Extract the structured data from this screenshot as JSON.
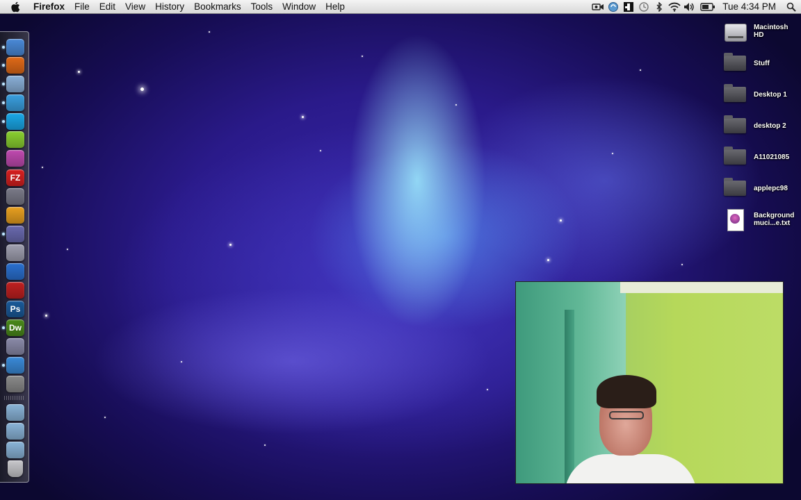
{
  "menubar": {
    "apple_icon": "apple-icon",
    "app_name": "Firefox",
    "menus": [
      "File",
      "Edit",
      "View",
      "History",
      "Bookmarks",
      "Tools",
      "Window",
      "Help"
    ],
    "status_icons": [
      "video-camera-icon",
      "sync-icon",
      "extension-icon",
      "time-machine-icon",
      "bluetooth-icon",
      "wifi-icon",
      "volume-icon",
      "battery-icon"
    ],
    "clock": "Tue 4:34 PM",
    "spotlight_icon": "search-icon"
  },
  "dock": {
    "items": [
      {
        "name": "finder",
        "icon": "finder-icon",
        "color": "#4a8ad8",
        "running": true
      },
      {
        "name": "firefox",
        "icon": "firefox-icon",
        "color": "#e06a18",
        "running": true
      },
      {
        "name": "preview",
        "icon": "preview-icon",
        "color": "#8ab0d8",
        "running": true
      },
      {
        "name": "itunes",
        "icon": "itunes-icon",
        "color": "#3aa0e0",
        "running": true
      },
      {
        "name": "skype",
        "icon": "skype-icon",
        "color": "#1aa8e8",
        "running": true
      },
      {
        "name": "limewire",
        "icon": "limewire-icon",
        "color": "#8ad030",
        "running": false
      },
      {
        "name": "photo-app",
        "icon": "photo-app-icon",
        "color": "#c04ab0",
        "running": false
      },
      {
        "name": "filezilla",
        "icon": "filezilla-icon",
        "color": "#d82020",
        "label": "FZ",
        "running": false
      },
      {
        "name": "script-editor",
        "icon": "script-editor-icon",
        "color": "#7a7a88",
        "running": false
      },
      {
        "name": "burn",
        "icon": "burn-icon",
        "color": "#e8a020",
        "running": false
      },
      {
        "name": "imovie",
        "icon": "imovie-icon",
        "color": "#6a6ab0",
        "running": true
      },
      {
        "name": "imovie-star",
        "icon": "star-icon",
        "color": "#a0a0b0",
        "running": false
      },
      {
        "name": "quicktime",
        "icon": "quicktime-icon",
        "color": "#2a70d0",
        "running": false
      },
      {
        "name": "photo-booth",
        "icon": "photo-booth-icon",
        "color": "#c02020",
        "running": false
      },
      {
        "name": "photoshop",
        "icon": "photoshop-icon",
        "color": "#1a5a9a",
        "label": "Ps",
        "running": false
      },
      {
        "name": "dreamweaver",
        "icon": "dreamweaver-icon",
        "color": "#4a8a1a",
        "label": "Dw",
        "running": true
      },
      {
        "name": "iphoto",
        "icon": "iphoto-icon",
        "color": "#8a8aa8",
        "running": false
      },
      {
        "name": "safari",
        "icon": "safari-icon",
        "color": "#3a8ad8",
        "running": true
      },
      {
        "name": "system-preferences",
        "icon": "gear-icon",
        "color": "#8a8a8a",
        "running": false
      },
      {
        "name": "applications-folder",
        "icon": "folder-icon",
        "color": "#8ab4d8",
        "running": false
      },
      {
        "name": "documents-folder",
        "icon": "folder-icon",
        "color": "#8ab4d8",
        "running": false
      },
      {
        "name": "downloads-folder",
        "icon": "download-folder-icon",
        "color": "#8ab4d8",
        "running": false
      },
      {
        "name": "trash",
        "icon": "trash-icon",
        "color": "#c8c8cc",
        "running": false
      }
    ]
  },
  "desktop": {
    "icons": [
      {
        "type": "hd",
        "label": "Macintosh HD",
        "icon": "hard-drive-icon"
      },
      {
        "type": "folder",
        "label": "Stuff",
        "icon": "folder-icon"
      },
      {
        "type": "folder",
        "label": "Desktop 1",
        "icon": "folder-icon"
      },
      {
        "type": "folder",
        "label": "desktop 2",
        "icon": "folder-icon"
      },
      {
        "type": "folder",
        "label": "A11021085",
        "icon": "folder-icon"
      },
      {
        "type": "folder",
        "label": "applepc98",
        "icon": "folder-icon"
      },
      {
        "type": "doc",
        "label": "Background muci...e.txt",
        "icon": "text-document-icon"
      }
    ]
  },
  "webcam": {
    "icon": "webcam-video-overlay"
  }
}
